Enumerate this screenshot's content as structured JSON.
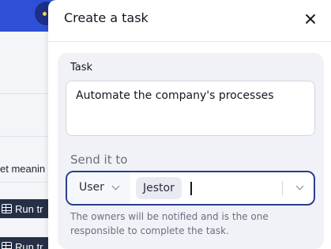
{
  "background": {
    "partial_text": "et meanin",
    "chips": [
      "Run tr",
      "Run tr"
    ]
  },
  "modal": {
    "title": "Create a task",
    "task_label": "Task",
    "task_value": "Automate the company's processes",
    "send_label": "Send it to",
    "recipient_type": "User",
    "selected_recipients": [
      "Jestor"
    ],
    "helper_text": "The owners will be notified and is the one responsible to complete the task."
  },
  "colors": {
    "accent": "#2b3d8f",
    "topbar": "#2f4fd6",
    "card_bg": "#f1f2f7"
  },
  "icons": {
    "close": "close-icon",
    "chevron": "chevron-down-icon",
    "table": "table-icon"
  }
}
